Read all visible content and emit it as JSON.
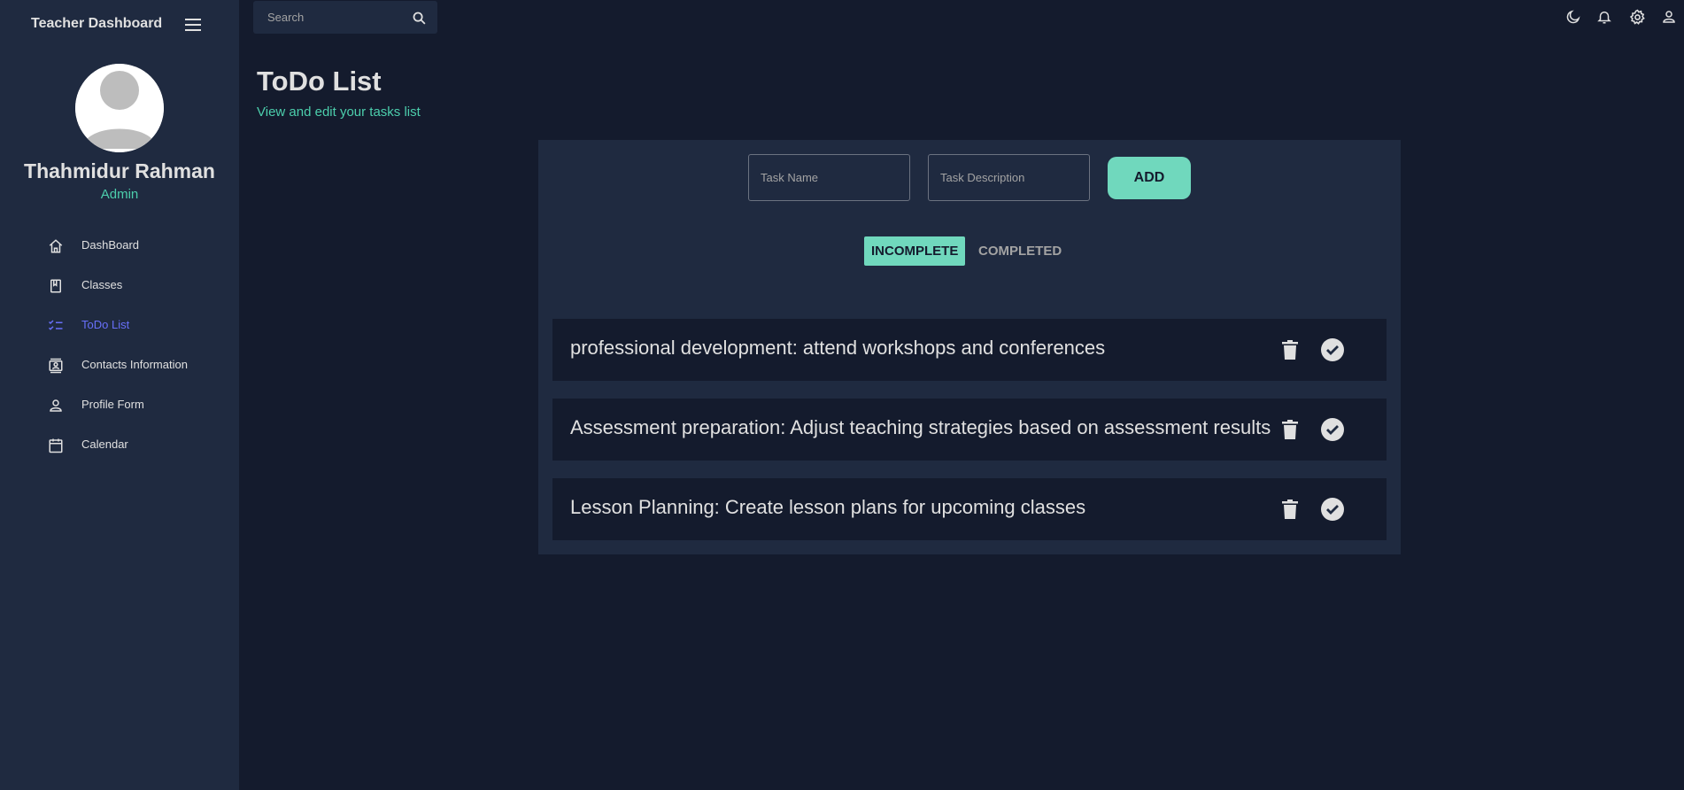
{
  "sidebar": {
    "brand": "Teacher Dashboard",
    "user": {
      "name": "Thahmidur Rahman",
      "role": "Admin"
    },
    "items": [
      {
        "label": "DashBoard",
        "icon": "home-icon"
      },
      {
        "label": "Classes",
        "icon": "book-icon"
      },
      {
        "label": "ToDo List",
        "icon": "checklist-icon",
        "active": true
      },
      {
        "label": "Contacts Information",
        "icon": "contact-card-icon"
      },
      {
        "label": "Profile Form",
        "icon": "person-icon"
      },
      {
        "label": "Calendar",
        "icon": "calendar-icon"
      }
    ]
  },
  "topbar": {
    "search_placeholder": "Search",
    "icons": [
      "dark-mode-icon",
      "notifications-icon",
      "settings-icon",
      "user-icon"
    ]
  },
  "header": {
    "title": "ToDo List",
    "subtitle": "View and edit your tasks list"
  },
  "form": {
    "task_name_placeholder": "Task Name",
    "task_description_placeholder": "Task Description",
    "add_label": "ADD"
  },
  "tabs": {
    "incomplete": "INCOMPLETE",
    "completed": "COMPLETED",
    "active": "incomplete"
  },
  "tasks": [
    {
      "text": "professional development: attend workshops and conferences"
    },
    {
      "text": "Assessment preparation: Adjust teaching strategies based on assessment results"
    },
    {
      "text": "Lesson Planning: Create lesson plans for upcoming classes"
    }
  ],
  "colors": {
    "background": "#141b2d",
    "panel": "#1f2a40",
    "accent": "#70d8bd",
    "accent_text": "#4cceac",
    "active_nav": "#6870fa"
  }
}
